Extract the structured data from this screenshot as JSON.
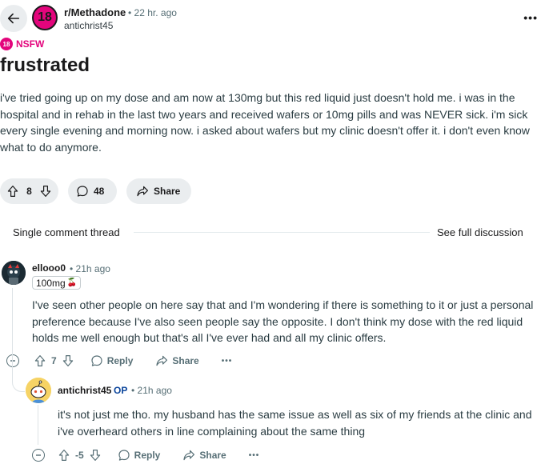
{
  "header": {
    "subreddit": "r/Methadone",
    "time": "• 22 hr. ago",
    "author": "antichrist45",
    "subreddit_badge": "18",
    "more": "•••"
  },
  "nsfw": {
    "badge": "18",
    "label": "NSFW"
  },
  "post": {
    "title": "frustrated",
    "body": "i've tried going up on my dose and am now at 130mg but this red liquid just doesn't hold me. i was in the hospital and in rehab in the last two years and received wafers or 10mg pills and was NEVER sick. i'm sick every single evening and morning now. i asked about wafers but my clinic doesn't offer it. i don't even know what to do anymore.",
    "upvotes": "8",
    "comments": "48",
    "share_label": "Share"
  },
  "thread": {
    "single_label": "Single comment thread",
    "see_full_label": "See full discussion"
  },
  "comments": [
    {
      "author": "ellooo0",
      "time": "• 21h ago",
      "flair": "100mg",
      "flair_emoji": "🍒",
      "body": "I've seen other people on here say that and I'm wondering if there is something to it or just a personal preference because I've also seen people say the opposite. I don't think my dose with the red liquid holds me well enough but that's all I've ever had and all my clinic offers.",
      "votes": "7",
      "reply_label": "Reply",
      "share_label": "Share",
      "more": "•••"
    },
    {
      "author": "antichrist45",
      "op_label": "OP",
      "time": "• 21h ago",
      "body": "it's not just me tho. my husband has the same issue as well as six of my friends at the clinic and i've overheard others in line complaining about the same thing",
      "votes": "-5",
      "reply_label": "Reply",
      "share_label": "Share",
      "more": "•••"
    }
  ],
  "colors": {
    "nsfw_pink": "#e3057c",
    "op_blue": "#0a449b",
    "pill_bg": "#eaedef",
    "meta_gray": "#576f76"
  }
}
